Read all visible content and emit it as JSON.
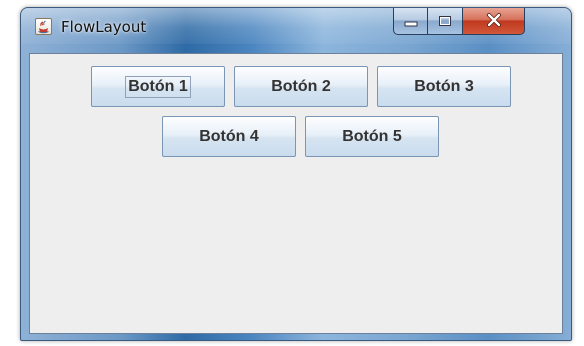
{
  "window": {
    "title": "FlowLayout"
  },
  "title_bar": {
    "app_icon": "java-cup-icon",
    "caption_buttons": [
      "minimize-icon",
      "maximize-icon",
      "close-icon"
    ],
    "close_color": "#c0391f"
  },
  "content": {
    "background": "#eeeeee",
    "buttons": [
      {
        "label": "Botón 1",
        "focused": true
      },
      {
        "label": "Botón 2",
        "focused": false
      },
      {
        "label": "Botón 3",
        "focused": false
      },
      {
        "label": "Botón 4",
        "focused": false
      },
      {
        "label": "Botón 5",
        "focused": false
      }
    ]
  }
}
